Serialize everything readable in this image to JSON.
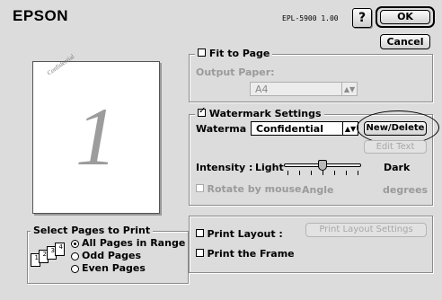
{
  "header": {
    "brand": "EPSON",
    "model": "EPL-5900  1.00",
    "help_label": "?",
    "ok_label": "OK",
    "cancel_label": "Cancel"
  },
  "preview": {
    "watermark_text": "Confidential",
    "page_number": "1"
  },
  "fit_to_page": {
    "label": "Fit to Page",
    "checked": false,
    "output_paper_label": "Output Paper:",
    "output_paper_value": "A4"
  },
  "watermark": {
    "label": "Watermark Settings",
    "checked": true,
    "name_label": "Waterma",
    "selected": "Confidential",
    "new_delete_label": "New/Delete",
    "edit_text_label": "Edit Text",
    "intensity_label": "Intensity :",
    "light_label": "Light",
    "dark_label": "Dark",
    "intensity_level": 0.5,
    "rotate_label": "Rotate by mouse",
    "angle_label": "Angle",
    "degrees_label": "degrees"
  },
  "pages": {
    "title": "Select Pages to Print",
    "options": [
      "All Pages in Range",
      "Odd Pages",
      "Even Pages"
    ],
    "selected_index": 0,
    "icon_numbers": [
      "1",
      "2",
      "3",
      "4"
    ]
  },
  "layout": {
    "print_layout_label": "Print Layout :",
    "print_layout_button": "Print Layout Settings",
    "print_frame_label": "Print the Frame"
  }
}
